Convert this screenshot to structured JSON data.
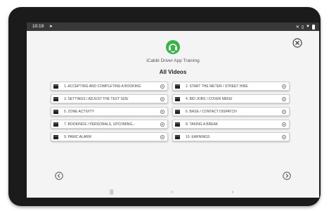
{
  "status_bar": {
    "time": "10:19",
    "send_icon": "send-icon",
    "icons": [
      "bluetooth-off-icon",
      "vibrate-icon",
      "wifi-icon",
      "battery-icon"
    ]
  },
  "header": {
    "logo_icon": "icabbi-training-logo",
    "subtitle": "iCabbi Driver App Training",
    "title": "All Videos"
  },
  "close_icon": "close-circle-icon",
  "videos": [
    {
      "label": "1. ACCEPTING AND COMPLETING A BOOKING"
    },
    {
      "label": "2. START THE METER / STREET HIRE"
    },
    {
      "label": "3. SETTINGS / ADJUST THE TEXT SIZE"
    },
    {
      "label": "4. BID JOBS / COVER MENU"
    },
    {
      "label": "5. ZONE ACTIVITY"
    },
    {
      "label": "6. BASE / CONTACT DISPATCH"
    },
    {
      "label": "7. BOOKINGS / PERSONALS, UPCOMING..."
    },
    {
      "label": "8. TAKING A BREAK"
    },
    {
      "label": "9. PANIC ALARM"
    },
    {
      "label": "10. EARNINGS"
    }
  ],
  "pager": {
    "prev_icon": "chevron-left-circle-icon",
    "next_icon": "chevron-right-circle-icon"
  },
  "nav_bar": {
    "recents": "|||",
    "home": "○",
    "back": "‹"
  },
  "colors": {
    "accent_green": "#3bb34a",
    "status_bar": "#383838",
    "device": "#1b1b1b"
  }
}
